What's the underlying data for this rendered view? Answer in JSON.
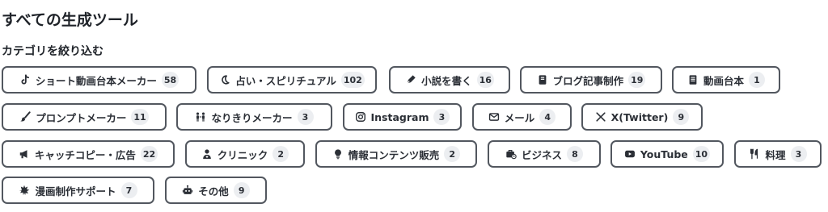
{
  "title": "すべての生成ツール",
  "filter_label": "カテゴリを絞り込む",
  "categories": [
    {
      "label": "ショート動画台本メーカー",
      "count": "58",
      "icon": "tiktok-icon"
    },
    {
      "label": "占い・スピリチュアル",
      "count": "102",
      "icon": "moon-icon"
    },
    {
      "label": "小説を書く",
      "count": "16",
      "icon": "pen-nib-icon"
    },
    {
      "label": "ブログ記事制作",
      "count": "19",
      "icon": "book-icon"
    },
    {
      "label": "動画台本",
      "count": "1",
      "icon": "script-icon"
    },
    {
      "label": "プロンプトメーカー",
      "count": "11",
      "icon": "brush-icon"
    },
    {
      "label": "なりきりメーカー",
      "count": "3",
      "icon": "people-icon"
    },
    {
      "label": "Instagram",
      "count": "3",
      "icon": "instagram-icon"
    },
    {
      "label": "メール",
      "count": "4",
      "icon": "envelope-icon"
    },
    {
      "label": "X(Twitter)",
      "count": "9",
      "icon": "x-logo-icon"
    },
    {
      "label": "キャッチコピー・広告",
      "count": "22",
      "icon": "megaphone-icon"
    },
    {
      "label": "クリニック",
      "count": "2",
      "icon": "doctor-icon"
    },
    {
      "label": "情報コンテンツ販売",
      "count": "2",
      "icon": "lightbulb-icon"
    },
    {
      "label": "ビジネス",
      "count": "8",
      "icon": "briefcase-icon"
    },
    {
      "label": "YouTube",
      "count": "10",
      "icon": "youtube-icon"
    },
    {
      "label": "料理",
      "count": "3",
      "icon": "utensils-icon"
    },
    {
      "label": "漫画制作サポート",
      "count": "7",
      "icon": "burst-icon"
    },
    {
      "label": "その他",
      "count": "9",
      "icon": "robot-icon"
    }
  ]
}
